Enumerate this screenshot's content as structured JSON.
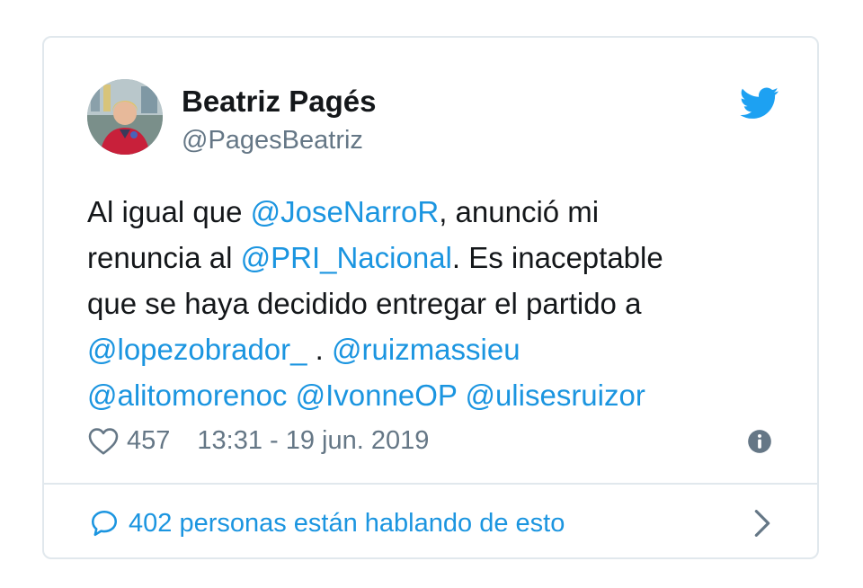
{
  "author": {
    "name": "Beatriz Pagés",
    "handle": "@PagesBeatriz"
  },
  "tweet": {
    "lines": [
      [
        {
          "t": "Al igual que ",
          "m": false
        },
        {
          "t": "@JoseNarroR",
          "m": true
        },
        {
          "t": ", anunció mi",
          "m": false
        }
      ],
      [
        {
          "t": "renuncia al ",
          "m": false
        },
        {
          "t": "@PRI_Nacional",
          "m": true
        },
        {
          "t": ". Es inaceptable",
          "m": false
        }
      ],
      [
        {
          "t": "que se haya decidido entregar el partido a",
          "m": false
        }
      ],
      [
        {
          "t": "@lopezobrador_",
          "m": true
        },
        {
          "t": " . ",
          "m": false
        },
        {
          "t": "@ruizmassieu",
          "m": true
        }
      ],
      [
        {
          "t": "@alitomorenoc",
          "m": true
        },
        {
          "t": " ",
          "m": false
        },
        {
          "t": "@IvonneOP",
          "m": true
        },
        {
          "t": " ",
          "m": false
        },
        {
          "t": "@ulisesruizor",
          "m": true
        }
      ]
    ]
  },
  "meta": {
    "likes": "457",
    "timestamp": "13:31 - 19 jun. 2019"
  },
  "footer": {
    "talk_label": "402 personas están hablando de esto"
  },
  "icons": {
    "like": "heart-icon",
    "info": "info-icon",
    "brand": "twitter-bird-icon",
    "reply": "speech-bubble-icon",
    "more": "chevron-right-icon"
  },
  "colors": {
    "link": "#1b95e0",
    "muted": "#657786",
    "text": "#14171a",
    "border": "#e1e8ed",
    "brand": "#1da1f2"
  }
}
